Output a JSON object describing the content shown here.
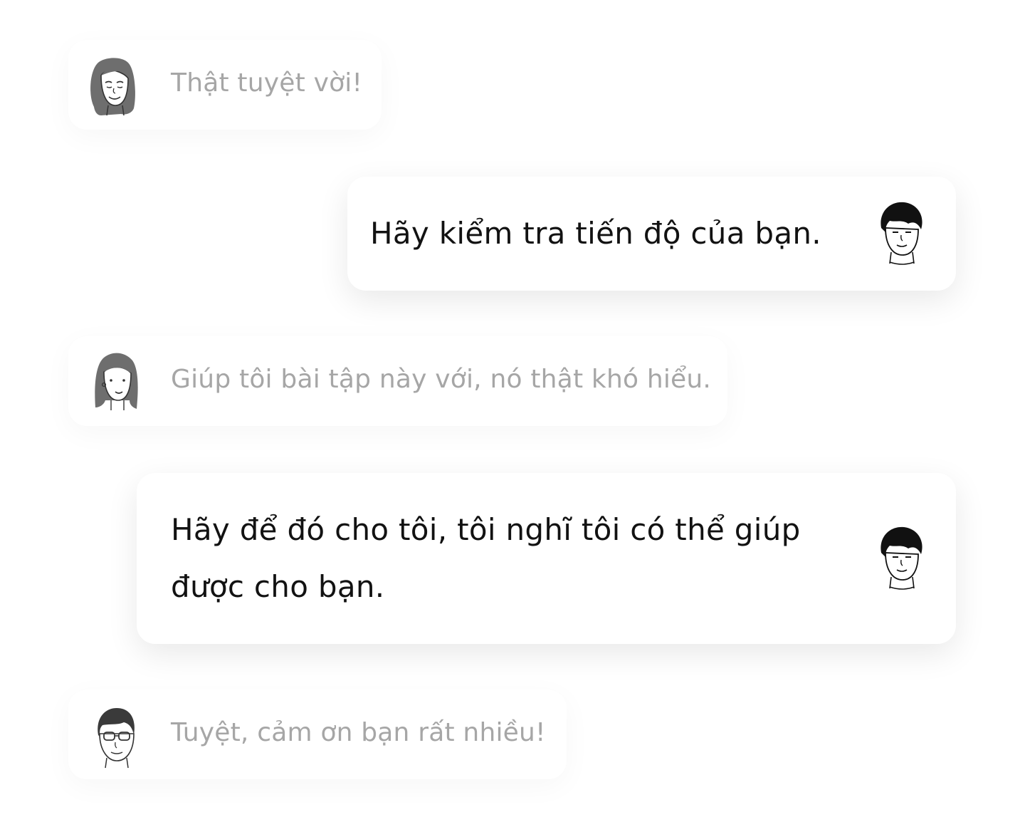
{
  "messages": [
    {
      "id": "m1",
      "direction": "incoming",
      "sender_avatar": "woman-short-hair-avatar-icon",
      "text": "Thật tuyệt vời!"
    },
    {
      "id": "m2",
      "direction": "outgoing",
      "sender_avatar": "man-black-hair-avatar-icon",
      "text": "Hãy kiểm tra tiến độ của bạn."
    },
    {
      "id": "m3",
      "direction": "incoming",
      "sender_avatar": "woman-long-hair-avatar-icon",
      "text": "Giúp tôi bài tập này với, nó thật khó hiểu."
    },
    {
      "id": "m4",
      "direction": "outgoing",
      "sender_avatar": "man-black-hair-avatar-icon",
      "text_line1": "Hãy để đó cho tôi, tôi nghĩ tôi có thể giúp",
      "text_line2": "được cho bạn."
    },
    {
      "id": "m5",
      "direction": "incoming",
      "sender_avatar": "man-glasses-avatar-icon",
      "text": "Tuyệt, cảm ơn bạn rất nhiều!"
    }
  ],
  "colors": {
    "incoming_text": "#a6a6a6",
    "outgoing_text": "#121212",
    "bubble_background": "#ffffff",
    "page_background": "#ffffff",
    "avatar_hair_gray": "#6e6e6e",
    "avatar_hair_black": "#111111"
  }
}
